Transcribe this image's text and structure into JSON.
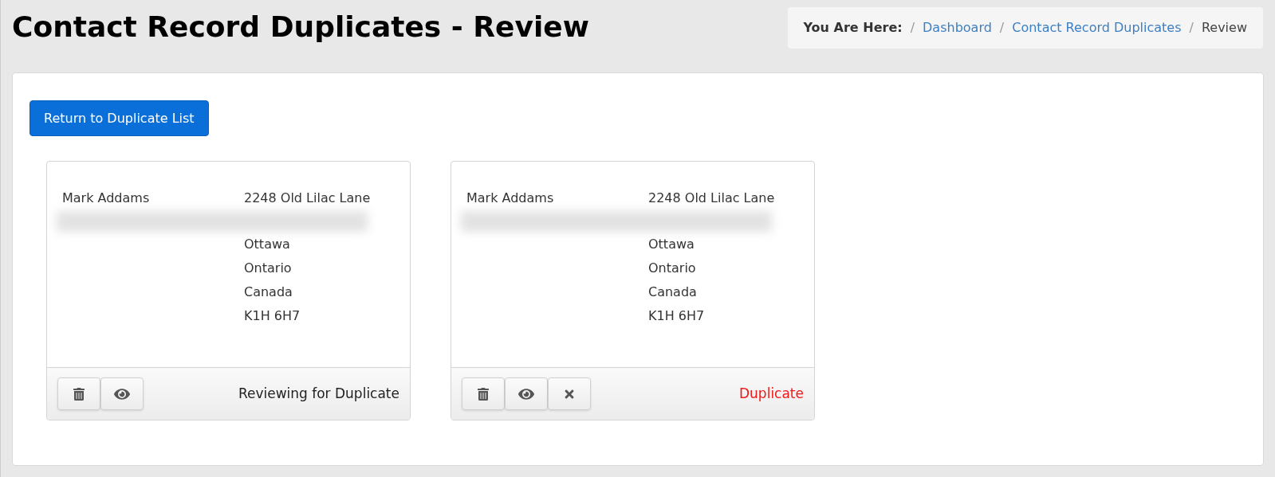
{
  "page_title": "Contact Record Duplicates - Review",
  "breadcrumb": {
    "label": "You Are Here:",
    "items": [
      {
        "separator": "/",
        "text": "Dashboard",
        "link": true
      },
      {
        "separator": "/",
        "text": "Contact Record Duplicates",
        "link": true
      },
      {
        "separator": "/",
        "text": "Review",
        "link": false
      }
    ]
  },
  "return_button": "Return to Duplicate List",
  "records": [
    {
      "name": "Mark Addams",
      "address": [
        "2248 Old Lilac Lane",
        "Ottawa",
        "Ontario",
        "Canada",
        "K1H 6H7"
      ],
      "actions": [
        {
          "kind": "delete"
        },
        {
          "kind": "view"
        }
      ],
      "status": {
        "text": "Reviewing for Duplicate",
        "kind": "reviewing"
      }
    },
    {
      "name": "Mark Addams",
      "address": [
        "2248 Old Lilac Lane",
        "Ottawa",
        "Ontario",
        "Canada",
        "K1H 6H7"
      ],
      "actions": [
        {
          "kind": "delete"
        },
        {
          "kind": "view"
        },
        {
          "kind": "dismiss"
        }
      ],
      "status": {
        "text": "Duplicate",
        "kind": "duplicate"
      }
    }
  ]
}
